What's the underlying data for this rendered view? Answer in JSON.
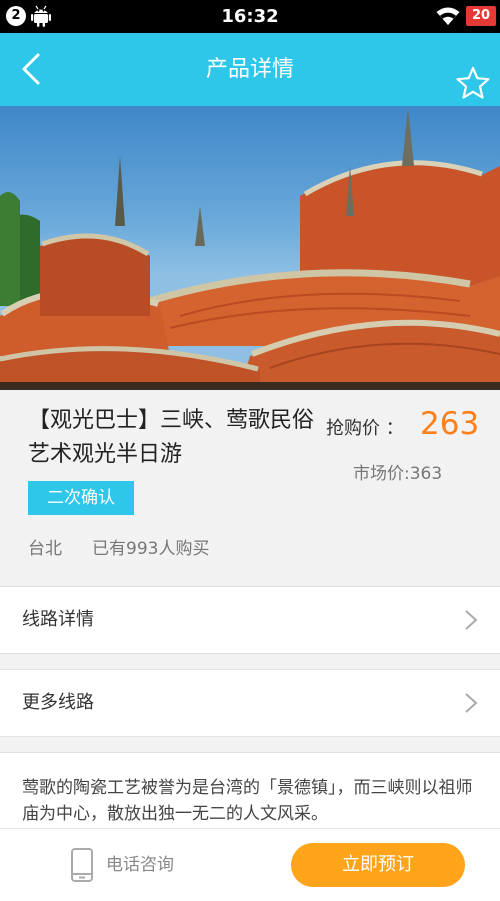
{
  "status_bar": {
    "notification_count": "2",
    "time": "16:32",
    "battery": "20"
  },
  "header": {
    "title": "产品详情",
    "back_icon": "chevron-left-icon",
    "favorite_icon": "star-outline-icon"
  },
  "hero": {
    "image": "temple-roof-photo"
  },
  "product": {
    "title": "【观光巴士】三峡、莺歌民俗艺术观光半日游",
    "price_label": "抢购价 ：",
    "price": "263",
    "market_price": "市场价:363",
    "confirm_badge": "二次确认",
    "location": "台北",
    "buyers": "已有993人购买"
  },
  "rows": [
    {
      "label": "线路详情"
    },
    {
      "label": "更多线路"
    }
  ],
  "description": "莺歌的陶瓷工艺被誉为是台湾的「景德镇」，而三峡则以祖师庙为中心，散放出独一无二的人文风采。",
  "bottom_bar": {
    "phone_label": "电话咨询",
    "book_label": "立即预订"
  },
  "colors": {
    "accent": "#2ec7ea",
    "price": "#ff7f1a",
    "book_button": "#ffa41b",
    "battery": "#e53935"
  }
}
